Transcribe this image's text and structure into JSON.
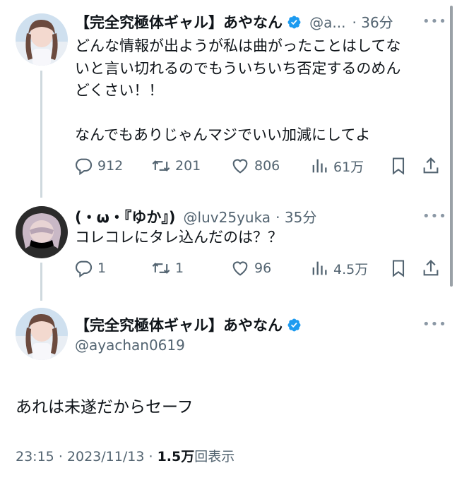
{
  "tweet1": {
    "name": "【完全究極体ギャル】あやなん",
    "handle": "@a...",
    "time": "· 36分",
    "lines": [
      "どんな情報が出ようが私は曲がったことはしてな",
      "いと言い切れるのでもういちいち否定するのめん",
      "どくさい！！",
      "なんでもありじゃんマジでいい加減にしてよ"
    ],
    "stats": {
      "replies": "912",
      "retweets": "201",
      "likes": "806",
      "views": "61万"
    }
  },
  "tweet2": {
    "name": "(・ω・『ゆか』)",
    "handle": "@luv25yuka",
    "time": "· 35分",
    "text": "コレコレにタレ込んだのは？？",
    "stats": {
      "replies": "1",
      "retweets": "1",
      "likes": "96",
      "views": "4.5万"
    }
  },
  "main_tweet": {
    "name": "【完全究極体ギャル】あやなん",
    "handle": "@ayachan0619",
    "text": "あれは未遂だからセーフ",
    "time": "23:15",
    "sep": "·",
    "date": "2023/11/13",
    "views": "1.5万",
    "views_label": "回表示"
  },
  "icons": [
    "verified-badge-icon",
    "more-icon",
    "reply-icon",
    "retweet-icon",
    "like-icon",
    "views-icon",
    "bookmark-icon",
    "share-icon"
  ],
  "colors": {
    "verified": "#1d9bf0",
    "secondary": "#536471",
    "thread_line": "#cfd9de"
  }
}
